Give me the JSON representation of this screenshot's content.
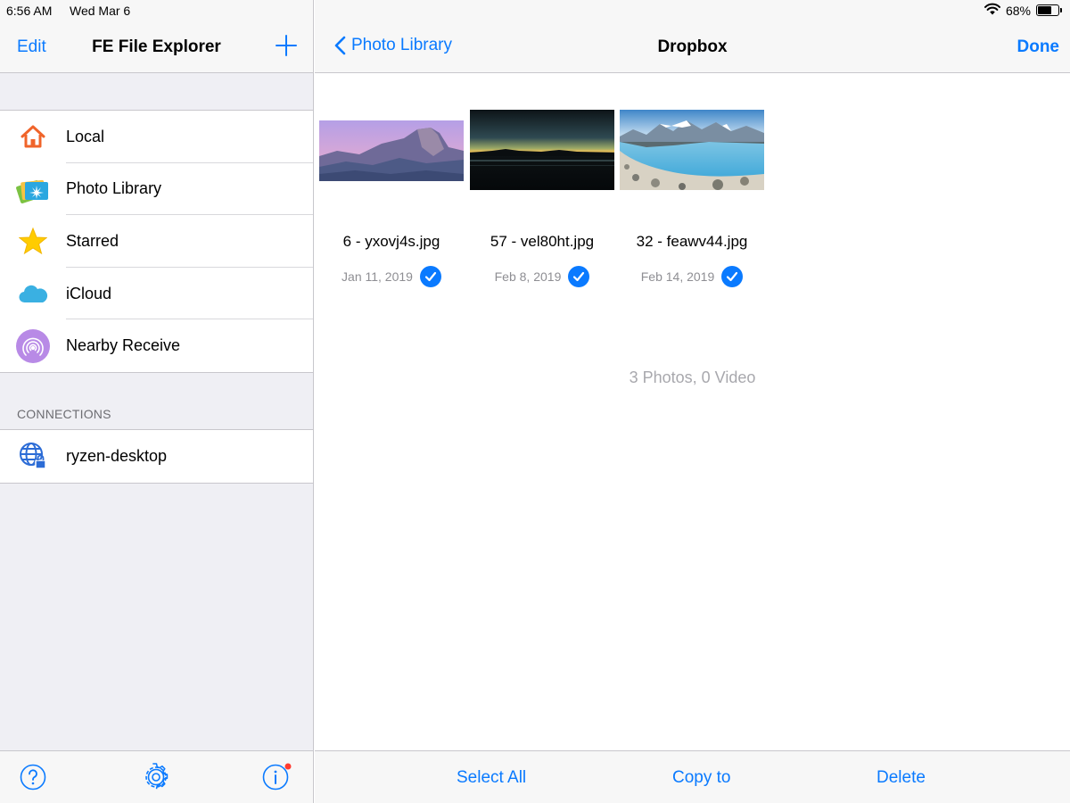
{
  "status_bar": {
    "time": "6:56 AM",
    "date": "Wed Mar 6",
    "battery": "68%",
    "battery_level": 0.68,
    "wifi_icon": "wifi-icon"
  },
  "sidebar": {
    "edit_label": "Edit",
    "title": "FE File Explorer",
    "add_icon": "plus-icon",
    "items": [
      {
        "label": "Local",
        "icon": "home-icon"
      },
      {
        "label": "Photo Library",
        "icon": "photo-library-icon"
      },
      {
        "label": "Starred",
        "icon": "star-icon"
      },
      {
        "label": "iCloud",
        "icon": "cloud-icon"
      },
      {
        "label": "Nearby Receive",
        "icon": "nearby-receive-icon"
      }
    ],
    "connections_header": "CONNECTIONS",
    "connections": [
      {
        "label": "ryzen-desktop",
        "icon": "globe-lock-icon"
      }
    ],
    "toolbar": {
      "help_icon": "help-icon",
      "settings_icon": "gear-icon",
      "info_icon": "info-icon"
    }
  },
  "main": {
    "back_label": "Photo Library",
    "title": "Dropbox",
    "done_label": "Done",
    "photos": [
      {
        "name": "6 - yxovj4s.jpg",
        "date": "Jan 11, 2019",
        "selected": true
      },
      {
        "name": "57 - vel80ht.jpg",
        "date": "Feb 8, 2019",
        "selected": true
      },
      {
        "name": "32 - feawv44.jpg",
        "date": "Feb 14, 2019",
        "selected": true
      }
    ],
    "count_text": "3 Photos, 0 Video",
    "toolbar": {
      "select_all": "Select All",
      "copy_to": "Copy to",
      "delete": "Delete"
    }
  },
  "colors": {
    "accent": "#0a7aff",
    "sidebar_bg": "#efeff4",
    "bar_bg": "#f7f7f7",
    "notification_dot": "#ff3b30"
  }
}
